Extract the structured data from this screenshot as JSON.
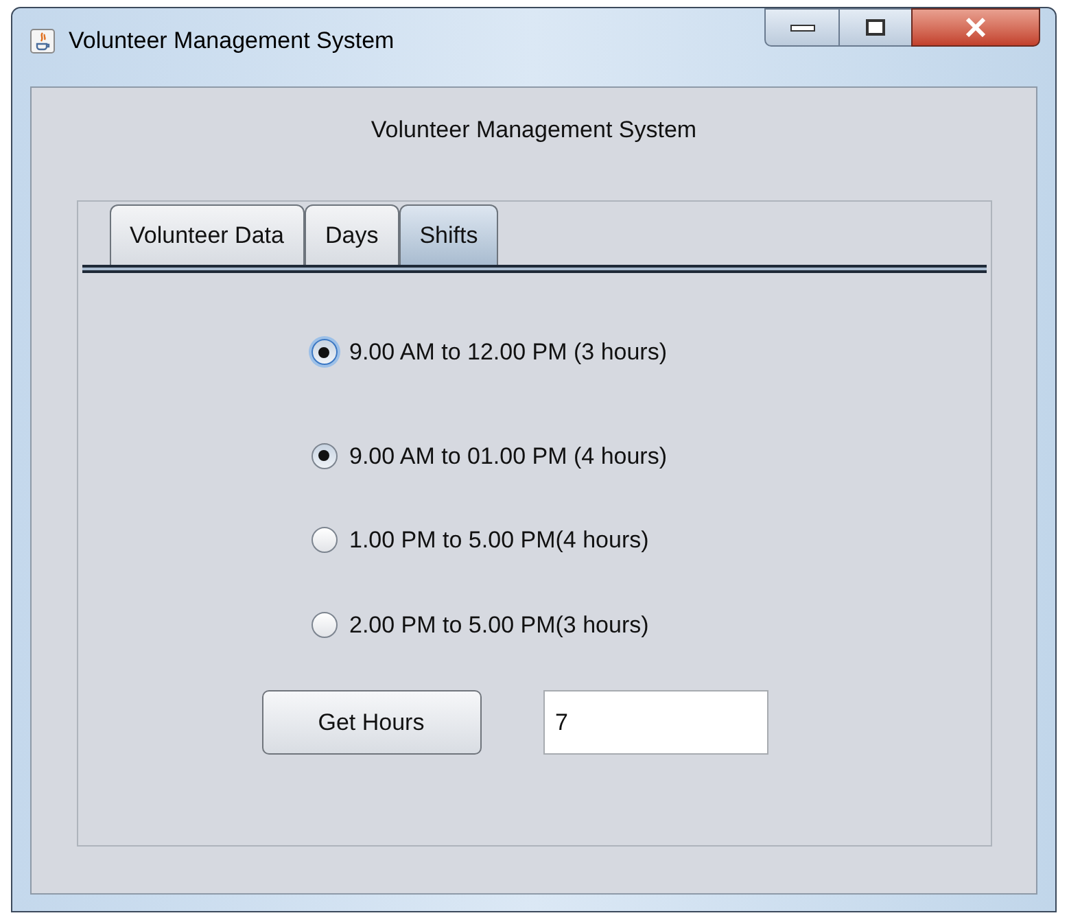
{
  "window": {
    "title": "Volunteer Management System"
  },
  "heading": "Volunteer Management System",
  "tabs": [
    {
      "label": "Volunteer Data",
      "selected": false
    },
    {
      "label": "Days",
      "selected": false
    },
    {
      "label": "Shifts",
      "selected": true
    }
  ],
  "shifts": [
    {
      "label": "9.00 AM to 12.00 PM (3 hours)",
      "selected": true,
      "focused": true
    },
    {
      "label": "9.00 AM to 01.00 PM (4 hours)",
      "selected": true,
      "focused": false
    },
    {
      "label": "1.00 PM to 5.00 PM(4 hours)",
      "selected": false,
      "focused": false
    },
    {
      "label": "2.00 PM to 5.00 PM(3 hours)",
      "selected": false,
      "focused": false
    }
  ],
  "button": "Get Hours",
  "hours_field": {
    "value": "7"
  }
}
